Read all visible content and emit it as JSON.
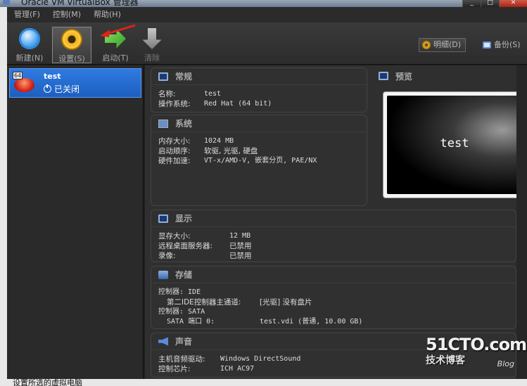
{
  "titlebar": {
    "title": "Oracle VM VirtualBox 管理器"
  },
  "menu": {
    "items": [
      "管理(F)",
      "控制(M)",
      "帮助(H)"
    ]
  },
  "toolbar": {
    "new_label": "新建(N)",
    "settings_label": "设置(S)",
    "start_label": "启动(T)",
    "discard_label": "清除",
    "details_label": "明细(D)",
    "snapshots_label": "备份(S)",
    "arrow_color": "#e0221a"
  },
  "vm": {
    "arch_badge": "64",
    "name": "test",
    "state": "已关闭"
  },
  "general": {
    "title": "常规",
    "name_key": "名称:",
    "name_val": "test",
    "os_key": "操作系统:",
    "os_val": "Red Hat (64 bit)"
  },
  "system": {
    "title": "系统",
    "mem_key": "内存大小:",
    "mem_val": "1024 MB",
    "boot_key": "启动顺序:",
    "boot_val": "软驱, 光驱, 硬盘",
    "accel_key": "硬件加速:",
    "accel_val": "VT-x/AMD-V, 嵌套分页, PAE/NX"
  },
  "preview": {
    "title": "预览",
    "screen_text": "test"
  },
  "display": {
    "title": "显示",
    "vram_key": "显存大小:",
    "vram_val": "12 MB",
    "rdp_key": "远程桌面服务器:",
    "rdp_val": "已禁用",
    "rec_key": "录像:",
    "rec_val": "已禁用"
  },
  "storage": {
    "title": "存储",
    "ctrl1": "控制器: IDE",
    "ctrl1_port_key": "第二IDE控制器主通道:",
    "ctrl1_port_val": "[光驱] 没有盘片",
    "ctrl2": "控制器: SATA",
    "ctrl2_port_key": "SATA 端口 0:",
    "ctrl2_port_val": "test.vdi (普通, 10.00 GB)"
  },
  "audio": {
    "title": "声音",
    "driver_key": "主机音频驱动:",
    "driver_val": "Windows DirectSound",
    "chip_key": "控制芯片:",
    "chip_val": "ICH AC97"
  },
  "statusbar": {
    "text": "设置所选的虚拟电脑"
  },
  "watermark": {
    "site": "51CTO.com",
    "sub": "技术博客",
    "blog": "Blog"
  }
}
